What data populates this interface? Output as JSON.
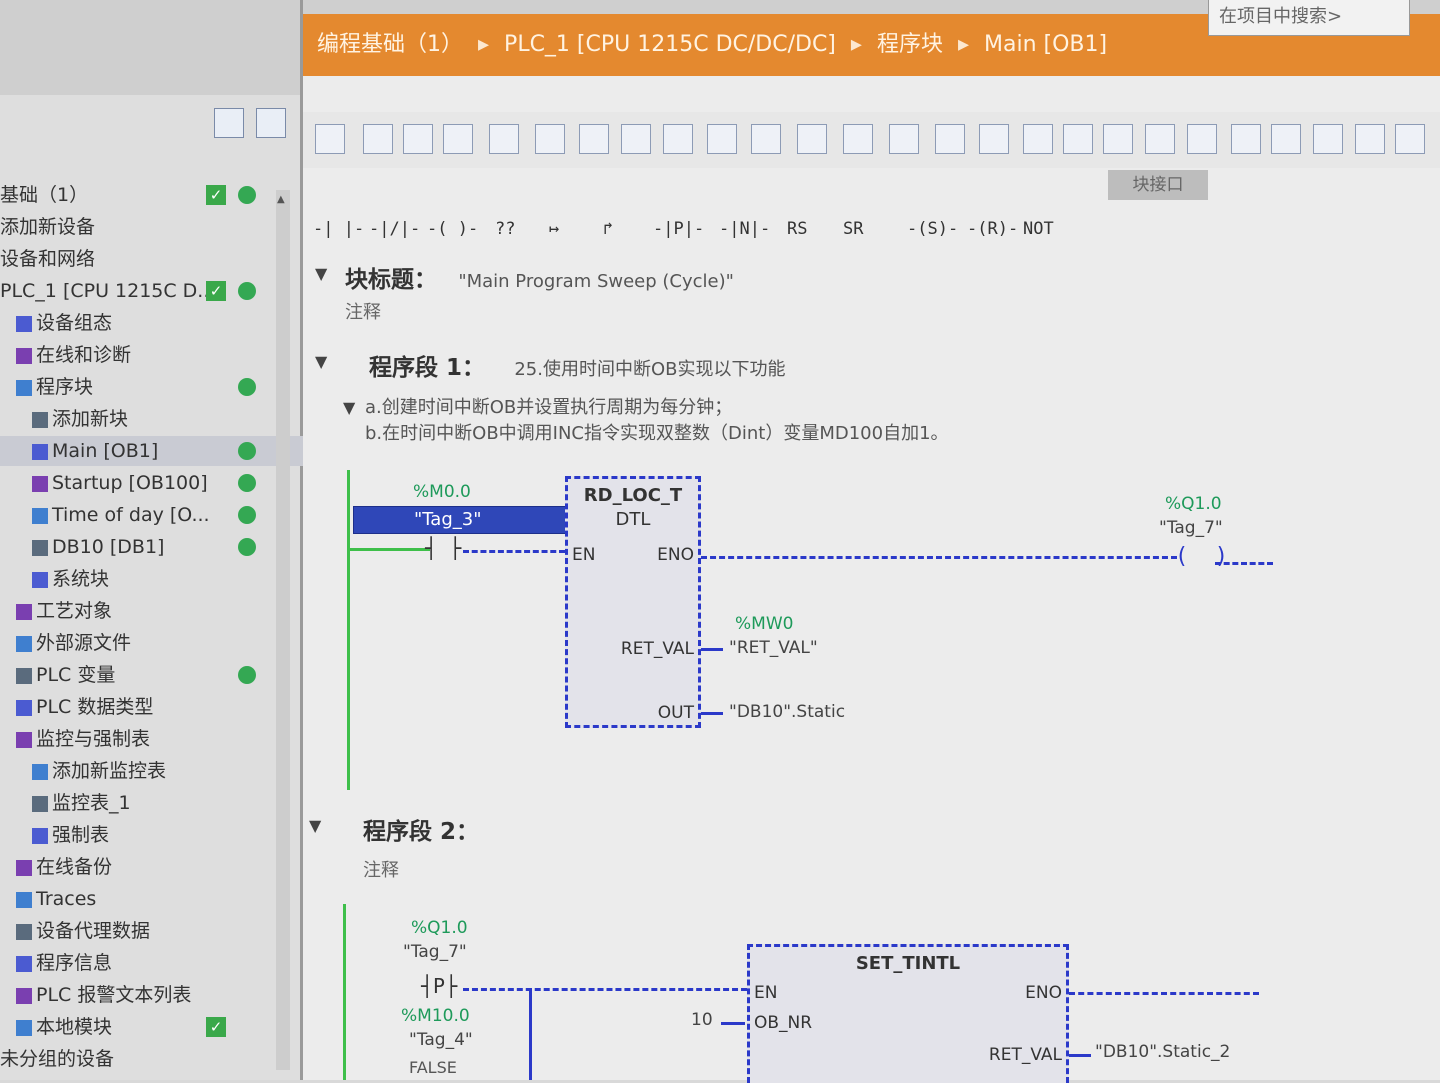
{
  "tree": {
    "items": [
      {
        "label": "基础（1）",
        "indent": 0,
        "dot": true,
        "check": true
      },
      {
        "label": "添加新设备",
        "indent": 0
      },
      {
        "label": "设备和网络",
        "indent": 0
      },
      {
        "label": "PLC_1 [CPU 1215C D...",
        "indent": 0,
        "dot": true,
        "check": true
      },
      {
        "label": "设备组态",
        "indent": 1
      },
      {
        "label": "在线和诊断",
        "indent": 1
      },
      {
        "label": "程序块",
        "indent": 1,
        "dot": true
      },
      {
        "label": "添加新块",
        "indent": 2
      },
      {
        "label": "Main [OB1]",
        "indent": 2,
        "dot": true,
        "selected": true
      },
      {
        "label": "Startup [OB100]",
        "indent": 2,
        "dot": true
      },
      {
        "label": "Time of day [O...",
        "indent": 2,
        "dot": true
      },
      {
        "label": "DB10 [DB1]",
        "indent": 2,
        "dot": true
      },
      {
        "label": "系统块",
        "indent": 2
      },
      {
        "label": "工艺对象",
        "indent": 1
      },
      {
        "label": "外部源文件",
        "indent": 1
      },
      {
        "label": "PLC 变量",
        "indent": 1,
        "dot": true
      },
      {
        "label": "PLC 数据类型",
        "indent": 1
      },
      {
        "label": "监控与强制表",
        "indent": 1
      },
      {
        "label": "添加新监控表",
        "indent": 2
      },
      {
        "label": "监控表_1",
        "indent": 2
      },
      {
        "label": "强制表",
        "indent": 2
      },
      {
        "label": "在线备份",
        "indent": 1
      },
      {
        "label": "Traces",
        "indent": 1
      },
      {
        "label": "设备代理数据",
        "indent": 1
      },
      {
        "label": "程序信息",
        "indent": 1
      },
      {
        "label": "PLC 报警文本列表",
        "indent": 1
      },
      {
        "label": "本地模块",
        "indent": 1,
        "check": true
      },
      {
        "label": "未分组的设备",
        "indent": 0
      }
    ]
  },
  "titlebar": {
    "crumbs": [
      "编程基础（1）",
      "PLC_1 [CPU 1215C DC/DC/DC]",
      "程序块",
      "Main [OB1]"
    ],
    "separator": "▸"
  },
  "project_search": {
    "placeholder": "在项目中搜索>"
  },
  "toolbar": {
    "interface_tab": "块接口"
  },
  "ladder_symbols": [
    "-| |-",
    "-|/|-",
    "-( )-",
    "??",
    "↦",
    "↱",
    "-|P|-",
    "-|N|-",
    "RS",
    "SR",
    "-(S)-",
    "-(R)-",
    "NOT"
  ],
  "block": {
    "title_label": "块标题：",
    "title_value": "\"Main Program Sweep (Cycle)\"",
    "comment": "注释"
  },
  "network1": {
    "label": "程序段 1：",
    "comment": "25.使用时间中断OB实现以下功能",
    "comment_a": "a.创建时间中断OB并设置执行周期为每分钟；",
    "comment_b": "b.在时间中断OB中调用INC指令实现双整数（Dint）变量MD100自加1。",
    "contact_addr": "%M0.0",
    "contact_tag": "\"Tag_3\"",
    "block_name": "RD_LOC_T",
    "block_type": "DTL",
    "pin_en": "EN",
    "pin_eno": "ENO",
    "pin_retval": "RET_VAL",
    "pin_out": "OUT",
    "retval_addr": "%MW0",
    "retval_tag": "\"RET_VAL\"",
    "out_tag": "\"DB10\".Static",
    "coil_addr": "%Q1.0",
    "coil_tag": "\"Tag_7\""
  },
  "network2": {
    "label": "程序段 2：",
    "comment": "注释",
    "contact1_addr": "%Q1.0",
    "contact1_tag": "\"Tag_7\"",
    "contact2_addr": "%M10.0",
    "contact2_tag": "\"Tag_4\"",
    "false_text": "FALSE",
    "block_name": "SET_TINTL",
    "pin_en": "EN",
    "pin_eno": "ENO",
    "pin_obnr": "OB_NR",
    "obnr_value": "10",
    "pin_retval": "RET_VAL",
    "retval_tag": "\"DB10\".Static_2"
  }
}
